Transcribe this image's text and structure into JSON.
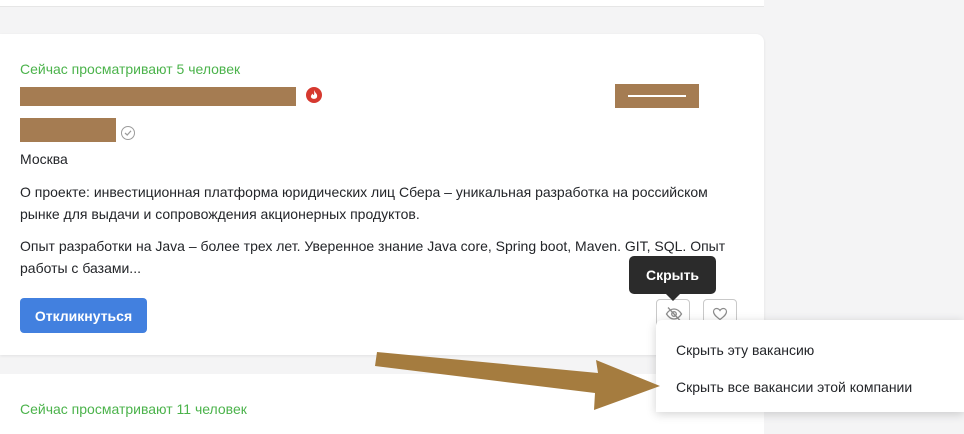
{
  "vacancy": {
    "viewers_text": "Сейчас просматривают 5 человек",
    "city": "Москва",
    "description_1": "О проекте: инвестиционная платформа юридических лиц Сбера – уникальная разработка на российском рынке для выдачи и сопровождения акционерных продуктов.",
    "description_2": "Опыт разработки на Java – более трех лет. Уверенное знание Java core, Spring boot, Maven. GIT, SQL. Опыт работы с базами...",
    "respond_label": "Откликнуться",
    "hide_tooltip": "Скрыть"
  },
  "hide_menu": {
    "items": [
      {
        "label": "Скрыть эту вакансию"
      },
      {
        "label": "Скрыть все вакансии этой компании"
      }
    ]
  },
  "next_vacancy": {
    "viewers_text": "Сейчас просматривают 11 человек"
  },
  "colors": {
    "accent": "#4280df",
    "viewers_green": "#4bb34b",
    "redaction": "#a57c52",
    "annotation_arrow": "#a57c3f"
  }
}
